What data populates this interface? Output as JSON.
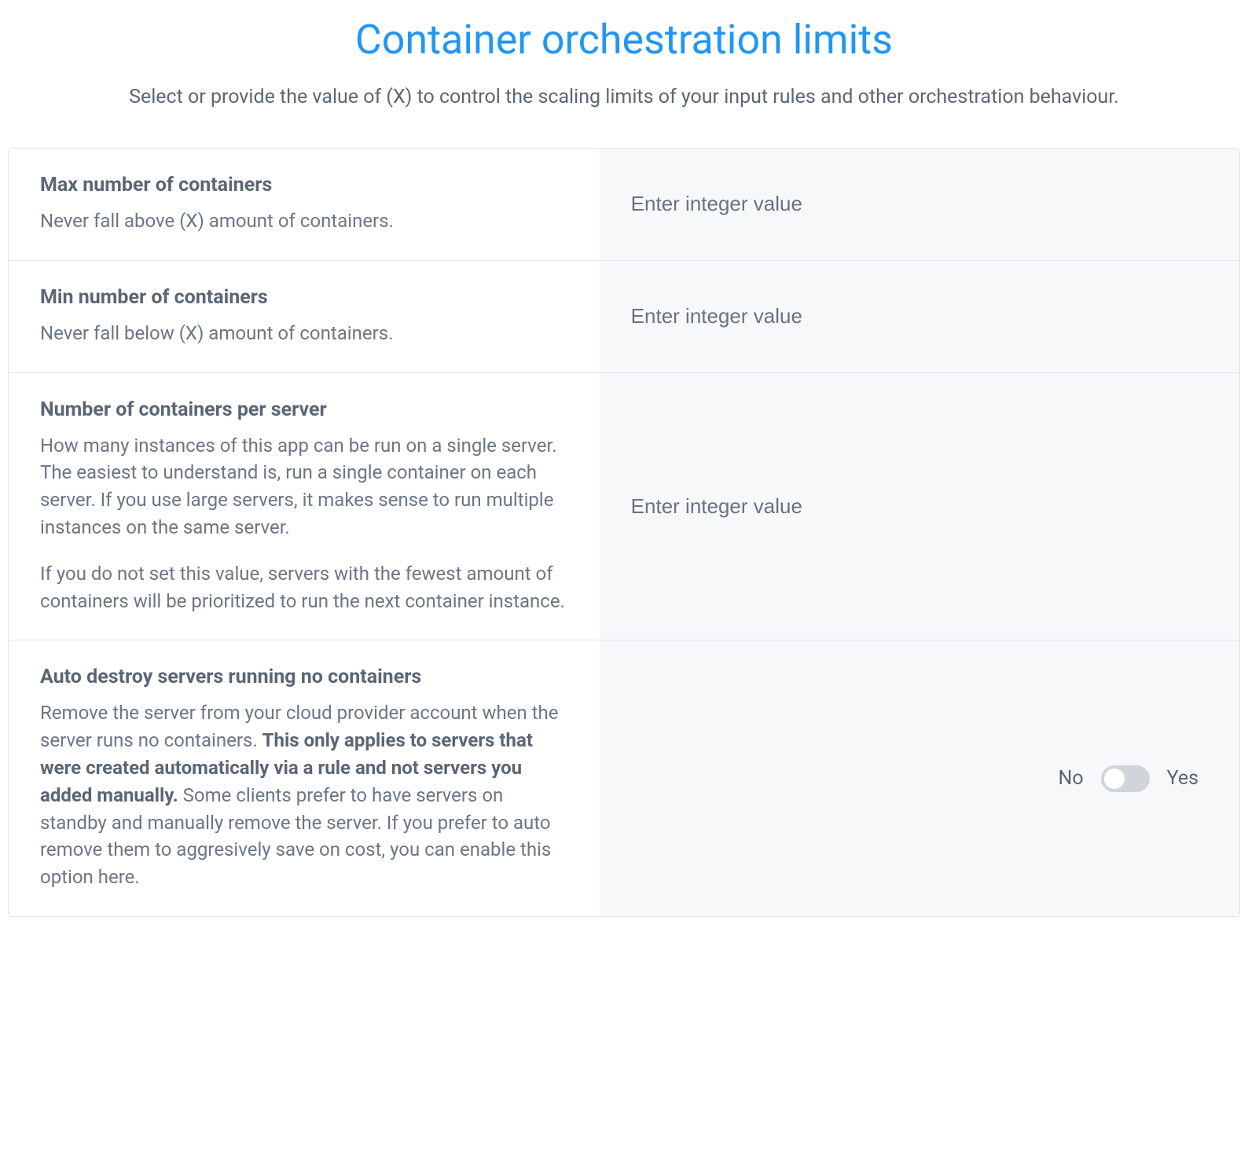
{
  "header": {
    "title": "Container orchestration limits",
    "subtitle": "Select or provide the value of (X) to control the scaling limits of your input rules and other orchestration behaviour."
  },
  "settings": {
    "max_containers": {
      "title": "Max number of containers",
      "desc": "Never fall above (X) amount of containers.",
      "placeholder": "Enter integer value"
    },
    "min_containers": {
      "title": "Min number of containers",
      "desc": "Never fall below (X) amount of containers.",
      "placeholder": "Enter integer value"
    },
    "per_server": {
      "title": "Number of containers per server",
      "desc1": "How many instances of this app can be run on a single server. The easiest to understand is, run a single container on each server. If you use large servers, it makes sense to run multiple instances on the same server.",
      "desc2": "If you do not set this value, servers with the fewest amount of containers will be prioritized to run the next container instance.",
      "placeholder": "Enter integer value"
    },
    "auto_destroy": {
      "title": "Auto destroy servers running no containers",
      "desc_pre": "Remove the server from your cloud provider account when the server runs no containers. ",
      "desc_bold": "This only applies to servers that were created automatically via a rule and not servers you added manually.",
      "desc_post": " Some clients prefer to have servers on standby and manually remove the server. If you prefer to auto remove them to aggresively save on cost, you can enable this option here.",
      "no_label": "No",
      "yes_label": "Yes",
      "value": false
    }
  }
}
